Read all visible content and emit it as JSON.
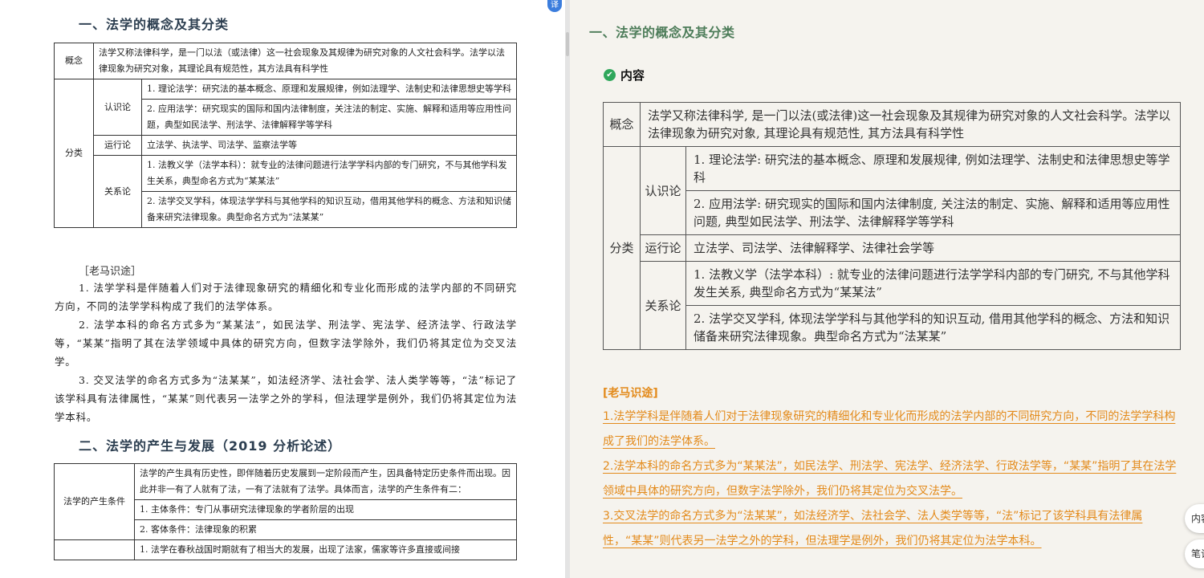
{
  "left": {
    "heading1": "一、法学的概念及其分类",
    "heading2": "二、法学的产生与发展（2019 分析论述）",
    "table1": {
      "concept_label": "概念",
      "concept_text": "法学又称法律科学，是一门以法（或法律）这一社会现象及其规律为研究对象的人文社会科学。法学以法律现象为研究对象，其理论具有规范性，其方法具有科学性",
      "classify_label": "分类",
      "renshi_label": "认识论",
      "renshi_1": "1. 理论法学：研究法的基本概念、原理和发展规律，例如法理学、法制史和法律思想史等学科",
      "renshi_2": "2. 应用法学：研究现实的国际和国内法律制度，关注法的制定、实施、解释和适用等应用性问题，典型如民法学、刑法学、法律解释学等学科",
      "yunxing_label": "运行论",
      "yunxing_text": "立法学、执法学、司法学、监察法学等",
      "guanxi_label": "关系论",
      "guanxi_1": "1. 法教义学（法学本科）：就专业的法律问题进行法学学科内部的专门研究，不与其他学科发生关系，典型命名方式为“某某法”",
      "guanxi_2": "2. 法学交叉学科，体现法学学科与其他学科的知识互动，借用其他学科的概念、方法和知识储备来研究法律现象。典型命名方式为“法某某”"
    },
    "note_title": "［老马识途］",
    "note_paras": [
      "1. 法学学科是伴随着人们对于法律现象研究的精细化和专业化而形成的法学内部的不同研究方向，不同的法学学科构成了我们的法学体系。",
      "2. 法学本科的命名方式多为“某某法”，如民法学、刑法学、宪法学、经济法学、行政法学等，“某某”指明了其在法学领域中具体的研究方向，但数字法学除外，我们仍将其定位为交叉法学。",
      "3. 交叉法学的命名方式多为“法某某”，如法经济学、法社会学、法人类学等等，“法”标记了该学科具有法律属性，“某某”则代表另一法学之外的学科，但法理学是例外，我们仍将其定位为法学本科。"
    ],
    "table2": {
      "cond_label": "法学的产生条件",
      "cond_text": "法学的产生具有历史性，即伴随着历史发展到一定阶段而产生，因具备特定历史条件而出现。因此并非一有了人就有了法，一有了法就有了法学。具体而言，法学的产生条件有二：",
      "cond_1": "1. 主体条件：专门从事研究法律现象的学者阶层的出现",
      "cond_2": "2. 客体条件：法律现象的积累",
      "cond_3": "1. 法学在春秋战国时期就有了相当大的发展，出现了法家，儒家等许多直接或间接"
    },
    "translate_glyph": "译"
  },
  "right": {
    "title": "一、法学的概念及其分类",
    "section_label": "内容",
    "check_glyph": "✔",
    "table": {
      "concept_label": "概念",
      "concept_text": "法学又称法律科学, 是一门以法(或法律)这一社会现象及其规律为研究对象的人文社会科学。法学以法律现象为研究对象, 其理论具有规范性, 其方法具有科学性",
      "classify_label": "分类",
      "renshi_label": "认识论",
      "renshi_1": "1. 理论法学: 研究法的基本概念、原理和发展规律, 例如法理学、法制史和法律思想史等学科",
      "renshi_2": "2. 应用法学: 研究现实的国际和国内法律制度, 关注法的制定、实施、解释和适用等应用性问题, 典型如民法学、刑法学、法律解释学等学科",
      "yunxing_label": "运行论",
      "yunxing_text": "立法学、司法学、法律解释学、法律社会学等",
      "guanxi_label": "关系论",
      "guanxi_1": "1. 法教义学（法学本科）: 就专业的法律问题进行法学学科内部的专门研究, 不与其他学科发生关系, 典型命名方式为“某某法”",
      "guanxi_2": "2. 法学交叉学科, 体现法学学科与其他学科的知识互动, 借用其他学科的概念、方法和知识储备来研究法律现象。典型命名方式为“法某某”"
    },
    "note_title": "[老马识途]",
    "notes": [
      "1.法学学科是伴随着人们对于法律现象研究的精细化和专业化而形成的法学内部的不同研究方向，不同的法学学科构成了我们的法学体系。",
      "2.法学本科的命名方式多为“某某法”，如民法学、刑法学、宪法学、经济法学、行政法学等，“某某”指明了其在法学领域中具体的研究方向，但数字法学除外，我们仍将其定位为交叉法学。",
      "3.交叉法学的命名方式多为“法某某”，如法经济学、法社会学、法人类学等等，“法”标记了该学科具有法律属性，“某某”则代表另一法学之外的学科，但法理学是例外，我们仍将其定位为法学本科。"
    ],
    "side_btn_content": "内容",
    "side_btn_notes": "笔记"
  },
  "colors": {
    "right_bg": "#f5f3ee",
    "title_green": "#4e7d5a",
    "note_orange": "#e38a1a",
    "check_green": "#2fa75b"
  }
}
